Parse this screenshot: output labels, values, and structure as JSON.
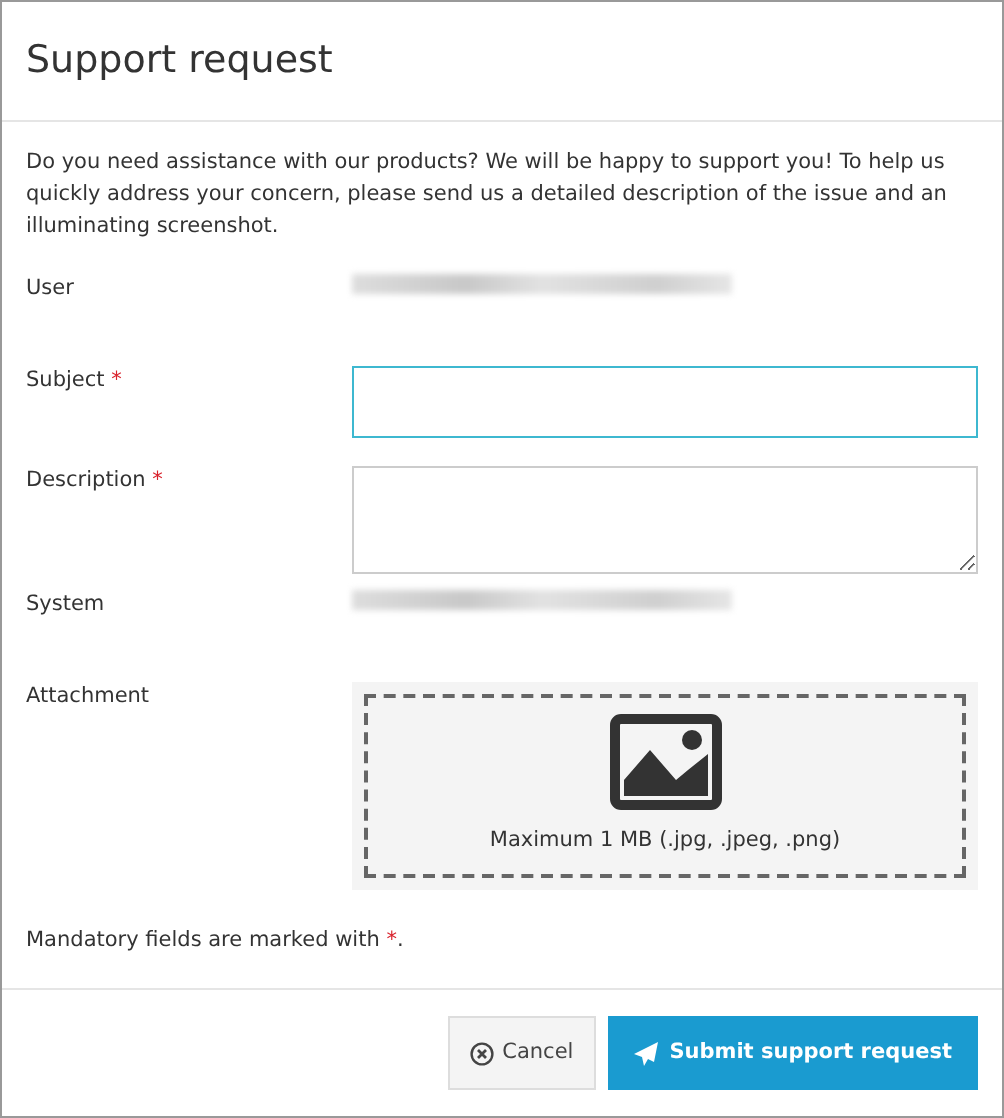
{
  "dialog": {
    "title": "Support request"
  },
  "intro": "Do you need assistance with our products? We will be happy to support you! To help us quickly address your concern, please send us a detailed description of the issue and an illuminating screenshot.",
  "fields": [
    {
      "label": "User",
      "kind": "redacted"
    },
    {
      "label": "Subject",
      "mark": "*",
      "kind": "input",
      "focused": true
    },
    {
      "label": "Description",
      "mark": "*",
      "kind": "textarea"
    },
    {
      "label": "System",
      "kind": "redacted"
    },
    {
      "label": "Attachment",
      "kind": "upload",
      "hint": "Maximum 1 MB (.jpg, .jpeg, .png)"
    }
  ],
  "note": {
    "text": "Mandatory fields are marked with",
    "mark": "*",
    "end": "."
  },
  "buttons": [
    {
      "label": "Cancel",
      "kind": "cancel"
    },
    {
      "label": "Submit support request",
      "kind": "submit"
    }
  ]
}
